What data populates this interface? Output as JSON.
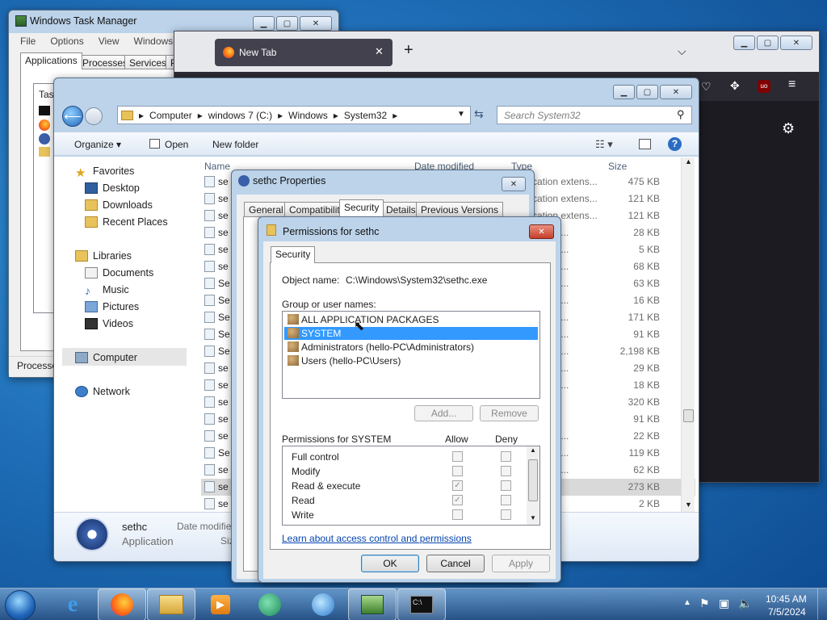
{
  "taskmgr": {
    "title": "Windows Task Manager",
    "menu": [
      "File",
      "Options",
      "View",
      "Windows"
    ],
    "tabs": [
      "Applications",
      "Processes",
      "Services",
      "P"
    ],
    "col": "Tas",
    "status": "Processe"
  },
  "browser": {
    "tab_title": "New Tab",
    "new_tab": "+"
  },
  "explorer": {
    "breadcrumb": [
      "Computer",
      "windows 7 (C:)",
      "Windows",
      "System32"
    ],
    "search_placeholder": "Search System32",
    "toolbar": {
      "organize": "Organize",
      "open": "Open",
      "new_folder": "New folder"
    },
    "nav": {
      "favorites": "Favorites",
      "desktop": "Desktop",
      "downloads": "Downloads",
      "recent": "Recent Places",
      "libraries": "Libraries",
      "documents": "Documents",
      "music": "Music",
      "pictures": "Pictures",
      "videos": "Videos",
      "computer": "Computer",
      "network": "Network"
    },
    "columns": {
      "name": "Name",
      "date": "Date modified",
      "type": "Type",
      "size": "Size"
    },
    "rows": [
      {
        "name": "se",
        "type": "cation extens...",
        "size": "475 KB"
      },
      {
        "name": "se",
        "type": "cation extens...",
        "size": "121 KB"
      },
      {
        "name": "se",
        "type": "cation extens...",
        "size": "121 KB"
      },
      {
        "name": "se",
        "type": "extens...",
        "size": "28 KB"
      },
      {
        "name": "se",
        "type": "extens...",
        "size": "5 KB"
      },
      {
        "name": "se",
        "type": "extens...",
        "size": "68 KB"
      },
      {
        "name": "Se",
        "type": "extens...",
        "size": "63 KB"
      },
      {
        "name": "Se",
        "type": "extens...",
        "size": "16 KB"
      },
      {
        "name": "Se",
        "type": "extens...",
        "size": "171 KB"
      },
      {
        "name": "Se",
        "type": "extens...",
        "size": "91 KB"
      },
      {
        "name": "Se",
        "type": "extens...",
        "size": "2,198 KB"
      },
      {
        "name": "se",
        "type": "extens...",
        "size": "29 KB"
      },
      {
        "name": "se",
        "type": "extens...",
        "size": "18 KB"
      },
      {
        "name": "se",
        "type": "",
        "size": "320 KB"
      },
      {
        "name": "se",
        "type": "omm...",
        "size": "91 KB"
      },
      {
        "name": "se",
        "type": "extens...",
        "size": "22 KB"
      },
      {
        "name": "Se",
        "type": "extens...",
        "size": "119 KB"
      },
      {
        "name": "se",
        "type": "extens...",
        "size": "62 KB"
      },
      {
        "name": "se",
        "type": "",
        "size": "273 KB"
      },
      {
        "name": "se",
        "type": "",
        "size": "2 KB"
      }
    ],
    "details": {
      "name": "sethc",
      "type": "Application",
      "date_label": "Date modifie",
      "size_label": "Siz"
    }
  },
  "props": {
    "title": "sethc Properties",
    "tabs": [
      "General",
      "Compatibility",
      "Security",
      "Details",
      "Previous Versions"
    ]
  },
  "perm": {
    "title": "Permissions for sethc",
    "tab": "Security",
    "object_label": "Object name:",
    "object_value": "C:\\Windows\\System32\\sethc.exe",
    "group_label": "Group or user names:",
    "users": [
      "ALL APPLICATION PACKAGES",
      "SYSTEM",
      "Administrators (hello-PC\\Administrators)",
      "Users (hello-PC\\Users)"
    ],
    "add": "Add...",
    "remove": "Remove",
    "perm_for": "Permissions for SYSTEM",
    "allow": "Allow",
    "deny": "Deny",
    "perms": [
      "Full control",
      "Modify",
      "Read & execute",
      "Read",
      "Write"
    ],
    "link": "Learn about access control and permissions",
    "ok": "OK",
    "cancel": "Cancel",
    "apply": "Apply"
  },
  "tray": {
    "time": "10:45 AM",
    "date": "7/5/2024"
  }
}
